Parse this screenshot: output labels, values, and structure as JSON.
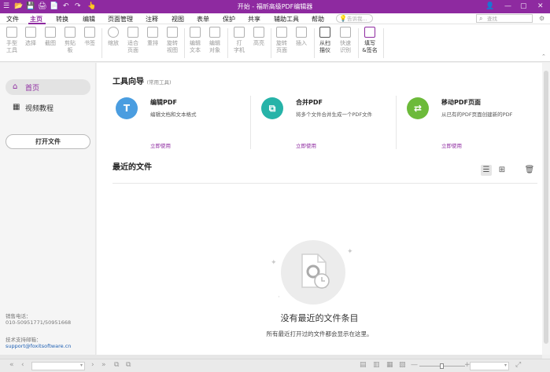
{
  "titlebar": {
    "title": "开始 - 福昕高级PDF编辑器",
    "quick_access": [
      "☰",
      "📂",
      "💾",
      "🖨",
      "📄",
      "↶",
      "↷",
      "👆"
    ],
    "right_icons": [
      "👤",
      "—",
      "▢",
      "✕"
    ]
  },
  "menu": {
    "items": [
      "文件",
      "主页",
      "转换",
      "编辑",
      "页面管理",
      "注释",
      "视图",
      "表单",
      "保护",
      "共享",
      "辅助工具",
      "帮助"
    ],
    "active": "主页",
    "search_placeholder": "告诉我...",
    "search2_placeholder": "查找"
  },
  "ribbon": {
    "buttons": [
      {
        "label": "手型\n工具",
        "enabled": false
      },
      {
        "label": "选择",
        "enabled": false
      },
      {
        "label": "截图",
        "enabled": false
      },
      {
        "label": "剪贴\n板",
        "enabled": false
      },
      {
        "label": "书签",
        "enabled": false
      },
      {
        "label": "缩放",
        "enabled": false
      },
      {
        "label": "适合\n页面",
        "enabled": false
      },
      {
        "label": "重排",
        "enabled": false
      },
      {
        "label": "旋转\n视图",
        "enabled": false
      },
      {
        "label": "编辑\n文本",
        "enabled": false
      },
      {
        "label": "编辑\n对象",
        "enabled": false
      },
      {
        "label": "打\n字机",
        "enabled": false
      },
      {
        "label": "高亮",
        "enabled": false
      },
      {
        "label": "旋转\n页面",
        "enabled": false
      },
      {
        "label": "插入",
        "enabled": false
      },
      {
        "label": "从扫\n描仪",
        "enabled": true
      },
      {
        "label": "快速\n识别",
        "enabled": false
      },
      {
        "label": "填写\n&签名",
        "enabled": true
      }
    ]
  },
  "sidebar": {
    "items": [
      {
        "label": "首页",
        "icon": "⌂",
        "active": true
      },
      {
        "label": "视频教程",
        "icon": "▦",
        "active": false
      }
    ],
    "open_button": "打开文件",
    "sales_label": "销售电话：",
    "sales_phone": "010-50951771/50951668",
    "support_label": "技术支持邮箱：",
    "support_email": "support@foxitsoftware.cn"
  },
  "main": {
    "wizard_title": "工具向导",
    "wizard_sub": "(常用工具)",
    "tools": [
      {
        "title": "编辑PDF",
        "desc": "编辑文档和文本格式",
        "link": "立即使用",
        "color": "#4a9de0",
        "icon": "T"
      },
      {
        "title": "合并PDF",
        "desc": "将多个文件合并生成一个PDF文件",
        "link": "立即使用",
        "color": "#26b3a8",
        "icon": "⧉"
      },
      {
        "title": "移动PDF页面",
        "desc": "从已有的PDF页面创建新的PDF",
        "link": "立即使用",
        "color": "#6cba3a",
        "icon": "⇄"
      }
    ],
    "recent_title": "最近的文件",
    "view_icons": [
      "☰",
      "⊞",
      "🗑"
    ],
    "empty_title": "没有最近的文件条目",
    "empty_sub": "所有最近打开过的文件都会显示在这里。"
  },
  "statusbar": {
    "left_icons": [
      "«",
      "‹",
      "›",
      "»",
      "⧉",
      "⧉"
    ],
    "right_icons": [
      "▤",
      "▥",
      "▦",
      "▧",
      "—",
      "+",
      "⤢"
    ]
  }
}
